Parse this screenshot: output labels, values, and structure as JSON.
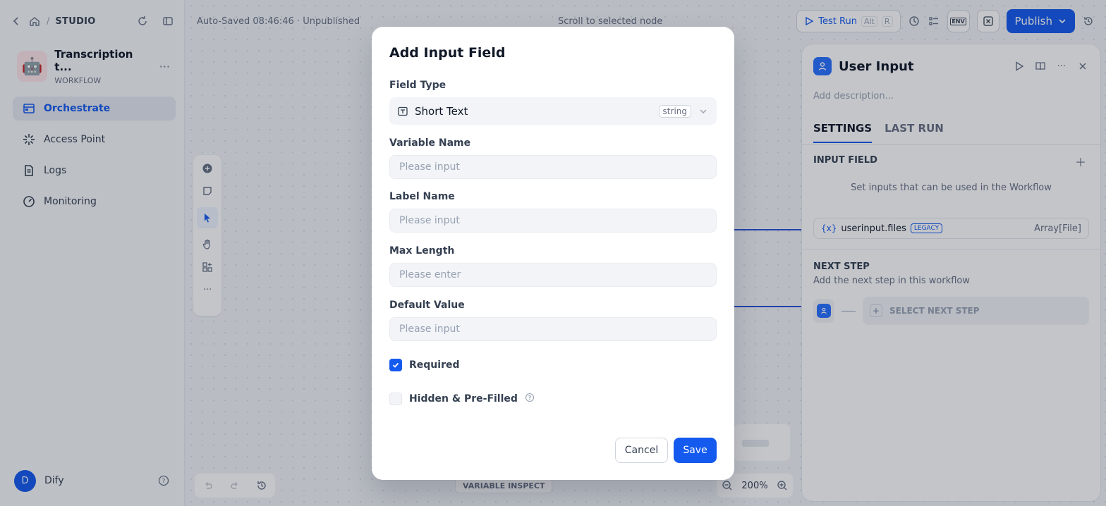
{
  "colors": {
    "accent": "#155aef",
    "node_blue": "#2970ff",
    "edge": "#2b4fd9"
  },
  "sidebar": {
    "breadcrumb": "STUDIO",
    "app": {
      "name": "Transcription t...",
      "type": "WORKFLOW",
      "avatar": "🤖"
    },
    "nav": [
      {
        "label": "Orchestrate",
        "icon": "layout-icon",
        "active": true
      },
      {
        "label": "Access Point",
        "icon": "sparkle-icon",
        "active": false
      },
      {
        "label": "Logs",
        "icon": "document-icon",
        "active": false
      },
      {
        "label": "Monitoring",
        "icon": "gauge-icon",
        "active": false
      }
    ],
    "user": {
      "initial": "D",
      "name": "Dify"
    }
  },
  "topbar": {
    "autosave": "Auto-Saved 08:46:46 · Unpublished",
    "scroll_to": "Scroll to selected node",
    "test_run": "Test Run",
    "shortcut_alt": "Alt",
    "shortcut_key": "R",
    "env_label": "ENV",
    "publish": "Publish"
  },
  "canvas": {
    "variable_inspect": "VARIABLE INSPECT",
    "zoom": "200%"
  },
  "panel": {
    "title": "User Input",
    "description_placeholder": "Add description...",
    "tabs": [
      "SETTINGS",
      "LAST RUN"
    ],
    "input_field_title": "INPUT FIELD",
    "input_field_note": "Set inputs that can be used in the Workflow",
    "variable": {
      "prefix": "{x}",
      "name": "userinput.files",
      "badge": "LEGACY",
      "type": "Array[File]"
    },
    "next_step_title": "NEXT STEP",
    "next_step_note": "Add the next step in this workflow",
    "select_next_step": "SELECT NEXT STEP"
  },
  "modal": {
    "title": "Add Input Field",
    "field_type_label": "Field Type",
    "field_type_value": "Short Text",
    "field_type_tag": "string",
    "variable_name_label": "Variable Name",
    "variable_name_placeholder": "Please input",
    "label_name_label": "Label Name",
    "label_name_placeholder": "Please input",
    "max_length_label": "Max Length",
    "max_length_placeholder": "Please enter",
    "default_value_label": "Default Value",
    "default_value_placeholder": "Please input",
    "required_label": "Required",
    "required_checked": true,
    "hidden_label": "Hidden & Pre-Filled",
    "hidden_checked": false,
    "cancel": "Cancel",
    "save": "Save"
  }
}
